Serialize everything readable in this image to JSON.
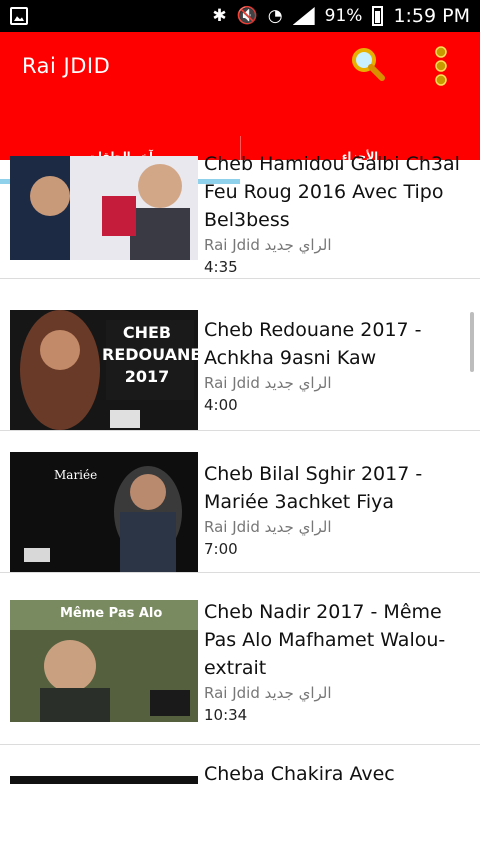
{
  "status_bar": {
    "battery": "91%",
    "time": "1:59 PM"
  },
  "app_bar": {
    "title": "Rai JDID"
  },
  "tabs": [
    {
      "label": "آخر الحلقات",
      "active": true
    },
    {
      "label": "الأجزاء",
      "active": false
    }
  ],
  "videos": [
    {
      "title": "Cheb Hamidou Galbi Ch3al Feu Roug 2016 Avec Tipo Bel3bess",
      "channel": "Rai Jdid الراي جديد",
      "duration": "4:35",
      "thumb_text": ""
    },
    {
      "title": "Cheb Redouane 2017 - Achkha 9asni Kaw",
      "channel": "Rai Jdid الراي جديد",
      "duration": "4:00",
      "thumb_text": "CHEB REDOUANE 2017"
    },
    {
      "title": "Cheb Bilal Sghir 2017 - Mariée 3achket Fiya",
      "channel": "Rai Jdid الراي جديد",
      "duration": "7:00",
      "thumb_text": "Mariée"
    },
    {
      "title": "Cheb Nadir 2017 - Même Pas Alo Mafhamet Walou-extrait",
      "channel": "Rai Jdid الراي جديد",
      "duration": "10:34",
      "thumb_text": "Même Pas Alo"
    },
    {
      "title": "Cheba Chakira Avec",
      "channel": "",
      "duration": "",
      "thumb_text": ""
    }
  ],
  "colors": {
    "appbar": "#ff0000",
    "tab_indicator": "#8fd0ea"
  }
}
